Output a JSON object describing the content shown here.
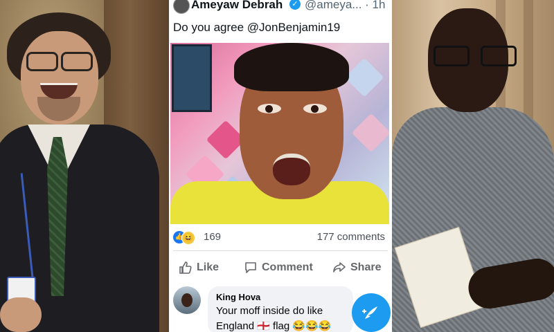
{
  "post": {
    "author": "Ameyaw Debrah",
    "handle": "@ameya... · 1h",
    "text": "Do you agree @JonBenjamin19",
    "reaction_count": "169",
    "comments_count": "177 comments",
    "actions": {
      "like": "Like",
      "comment": "Comment",
      "share": "Share"
    }
  },
  "comment": {
    "name": "King Hova",
    "line1": "Your moff inside do like",
    "line2": "England 🏴󠁧󠁢󠁥󠁮󠁧󠁿 flag 😂😂😂"
  },
  "colors": {
    "twitter_blue": "#1d9bf0",
    "facebook_blue": "#1877f2",
    "shirt_yellow": "#e8e23a"
  },
  "icons": {
    "verified": "verified-badge-icon",
    "like": "thumbs-up-icon",
    "comment": "speech-bubble-icon",
    "share": "share-arrow-icon",
    "compose": "compose-feather-icon"
  }
}
